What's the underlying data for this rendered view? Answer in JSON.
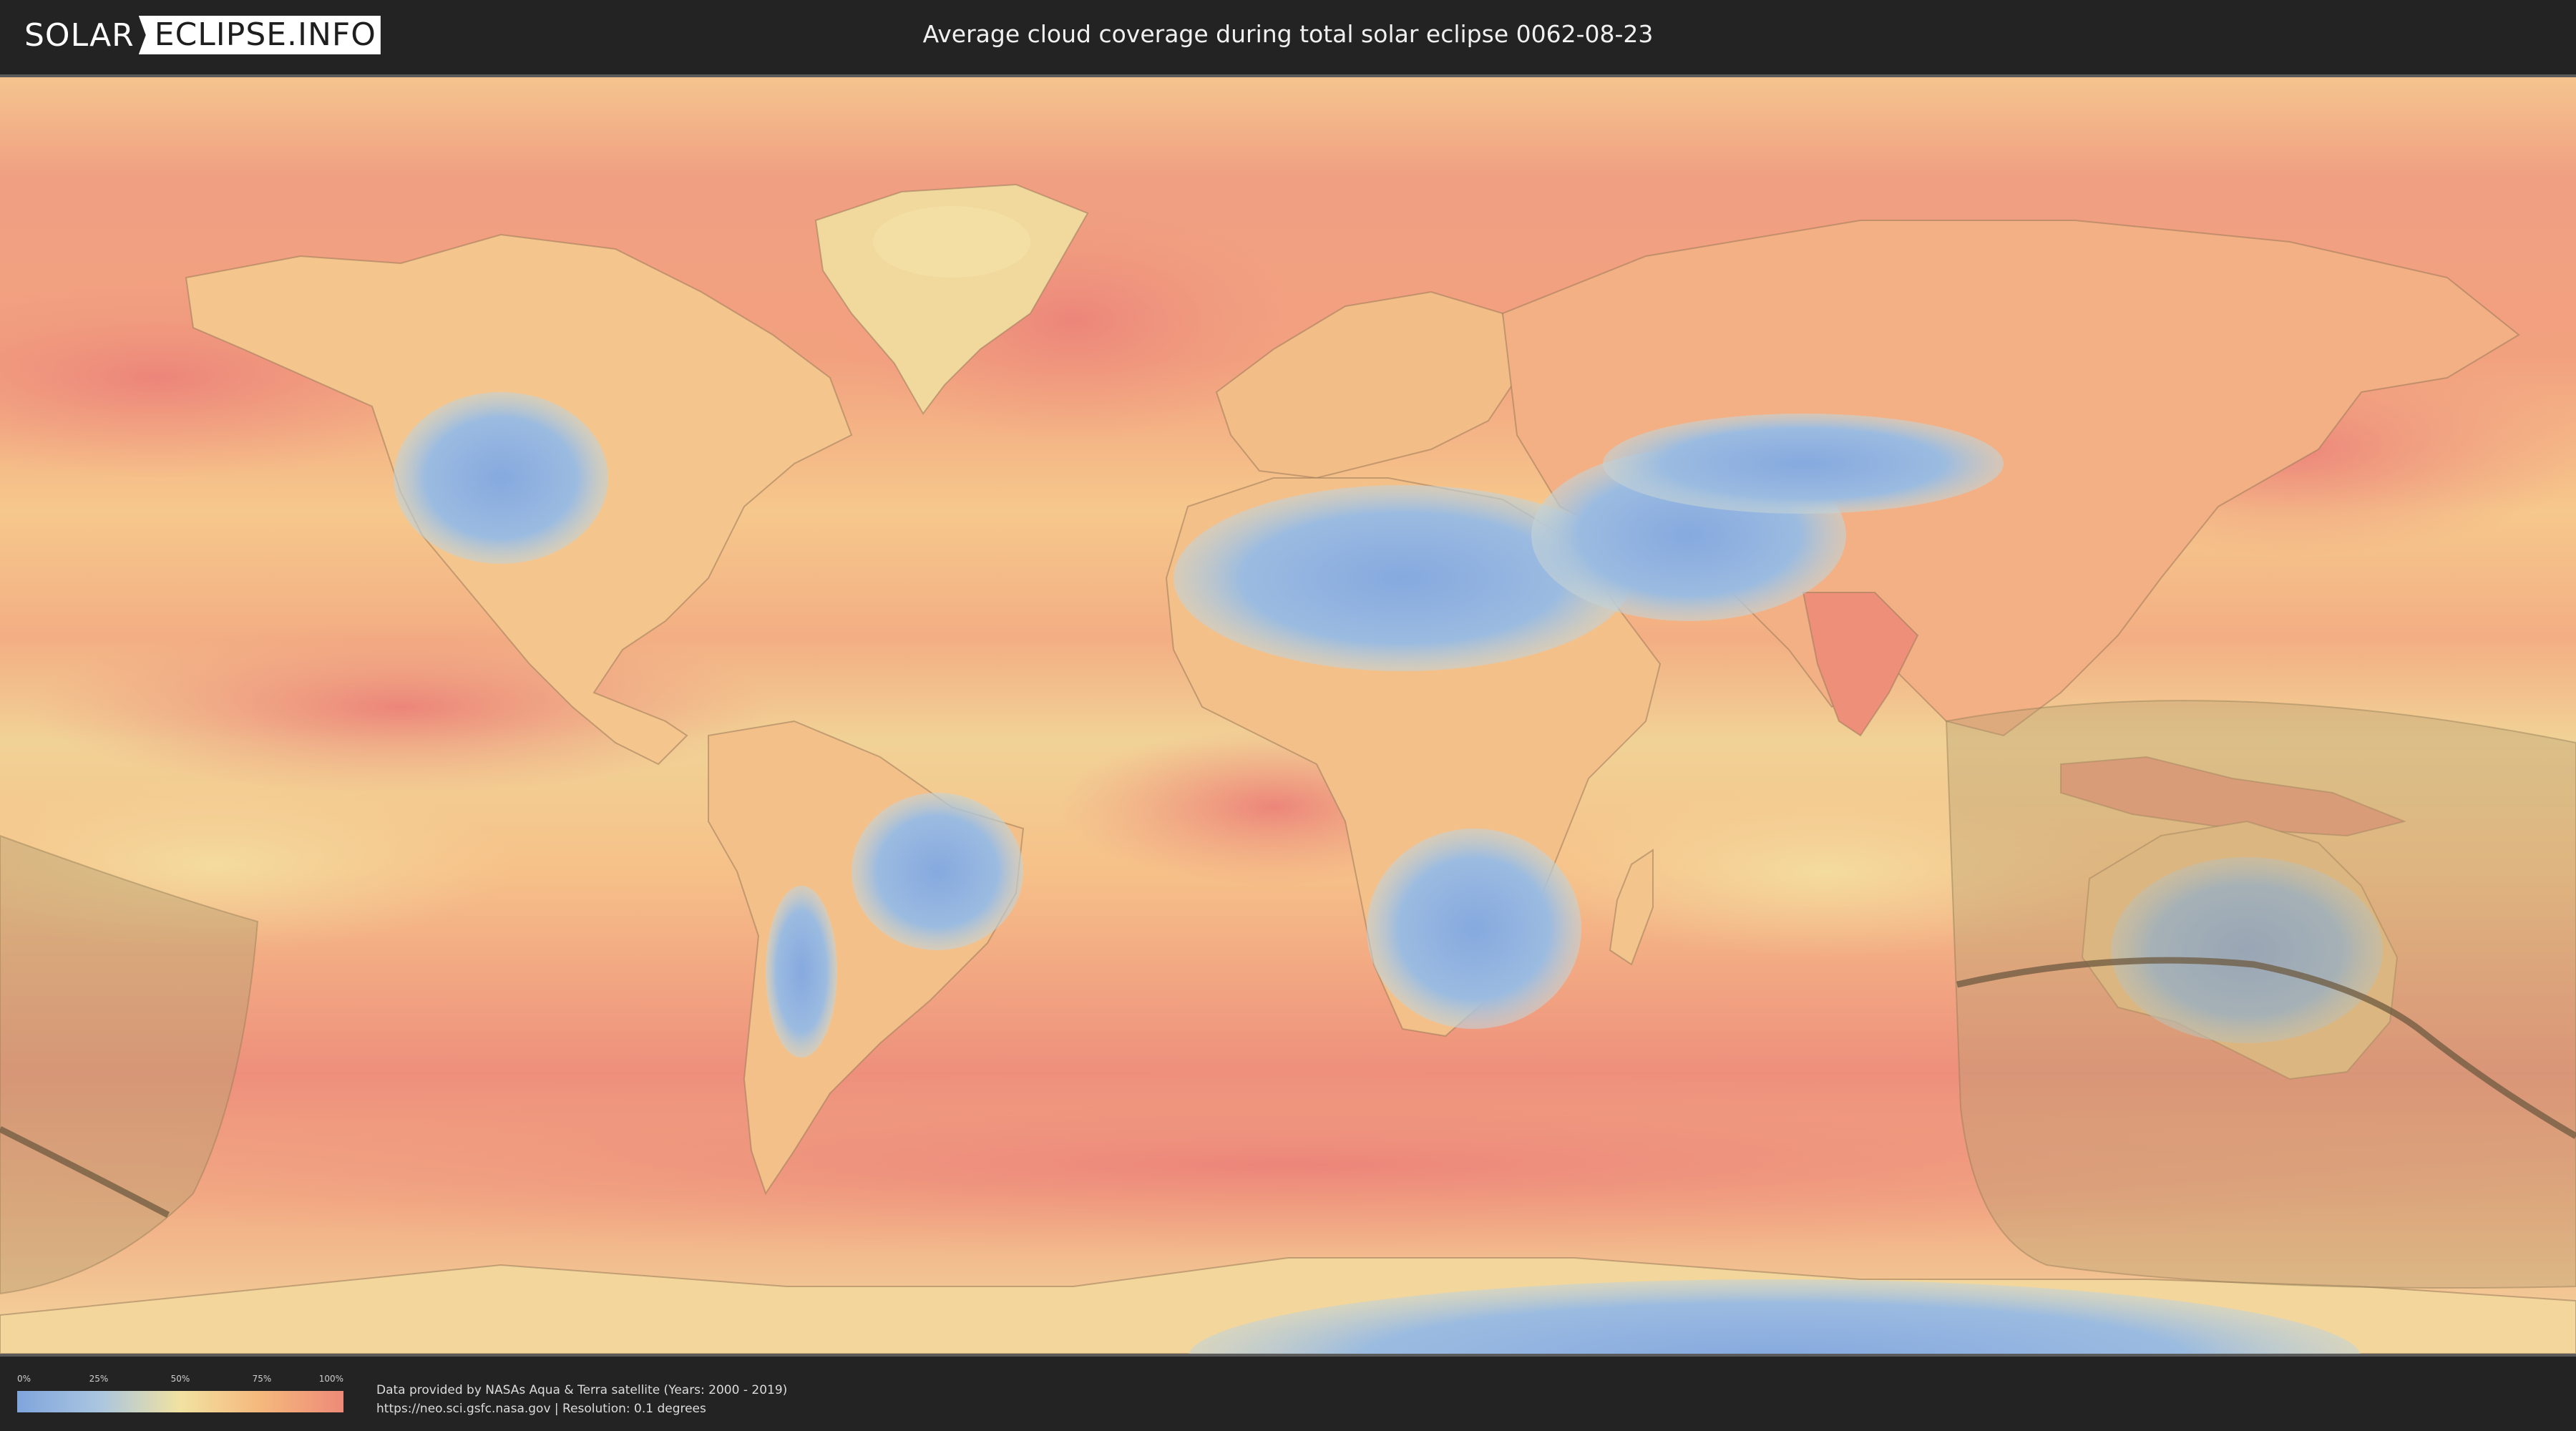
{
  "header": {
    "logo_part1": "SOLAR",
    "logo_part2": "ECLIPSE.INFO",
    "title": "Average cloud coverage during total solar eclipse 0062-08-23"
  },
  "legend": {
    "ticks": [
      "0%",
      "25%",
      "50%",
      "75%",
      "100%"
    ],
    "colors": [
      "#7fa5dc",
      "#a9c5e0",
      "#f1e2a1",
      "#f5b77c",
      "#ee8a78"
    ]
  },
  "footer": {
    "credit_line1": "Data provided by NASAs Aqua & Terra satellite (Years: 2000 - 2019)",
    "credit_line2": "https://neo.sci.gsfc.nasa.gov | Resolution: 0.1 degrees"
  },
  "map": {
    "projection": "equirectangular",
    "ocean_color": "#f2a880",
    "clear_color": "#8aaee0",
    "coast_color": "#9b7a5a",
    "eclipse_band_color": "#b8a070",
    "centerline_color": "#6e5a40"
  }
}
